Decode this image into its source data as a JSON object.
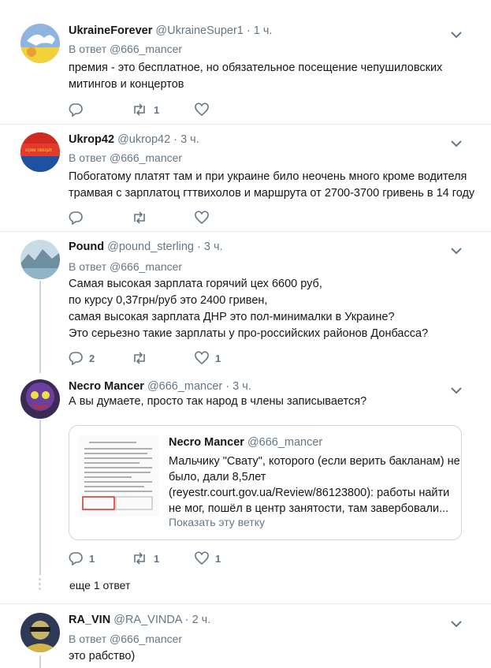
{
  "tweets": [
    {
      "name": "UkraineForever",
      "handle": "@UkraineSuper1",
      "time": "1 ч.",
      "reply_label": "В ответ",
      "reply_to": "@666_mancer",
      "lines": [
        "премия -  это бесплатное, но обязательное посещение чепушиловских",
        "митингов и концертов"
      ],
      "reply_count": "",
      "retweet_count": "1",
      "like_count": ""
    },
    {
      "name": "Ukrop42",
      "handle": "@ukrop42",
      "time": "3 ч.",
      "reply_label": "В ответ",
      "reply_to": "@666_mancer",
      "lines": [
        "Побогатому платят там и при украине било неочень много кроме водителя",
        "трамвая с зарплатоц гттвихолов и маршрута от 2700-3700 гривень в 14 году"
      ],
      "reply_count": "",
      "retweet_count": "",
      "like_count": ""
    },
    {
      "name": "Pound",
      "handle": "@pound_sterling",
      "time": "3 ч.",
      "reply_label": "В ответ",
      "reply_to": "@666_mancer",
      "lines": [
        "Самая высокая зарплата горячий цех 6600 руб,",
        "по курсу 0,37грн/руб это 2400 гривен,",
        "самая высокая зарплата ДНР это пол-минималки в Украине?",
        "Это серьезно такие зарплаты у про-российских районов Донбасса?"
      ],
      "reply_count": "2",
      "retweet_count": "",
      "like_count": "1"
    },
    {
      "name": "Necro Mancer",
      "handle": "@666_mancer",
      "time": "3 ч.",
      "lines": [
        "А вы думаете, просто так народ в члены записывается?"
      ],
      "reply_count": "1",
      "retweet_count": "1",
      "like_count": "1",
      "quote": {
        "name": "Necro Mancer",
        "handle": "@666_mancer",
        "lines": [
          "Мальчику \"Свату\", которого (если верить бакланам) не",
          "было, дали 8,5лет",
          "(reyestr.court.gov.ua/Review/86123800):  работы найти",
          "не мог, пошёл в центр занятости, там завербовали..."
        ],
        "show_thread": "Показать эту ветку"
      }
    },
    {
      "name": "RA_VIN",
      "handle": "@RA_VINDA",
      "time": "2 ч.",
      "reply_label": "В ответ",
      "reply_to": "@666_mancer",
      "lines": [
        "это рабство)"
      ]
    }
  ],
  "more_replies": "еще 1 ответ",
  "colors": {
    "secondary": "#657786",
    "divider": "#e6ecf0",
    "thread": "#ccd6dd"
  }
}
